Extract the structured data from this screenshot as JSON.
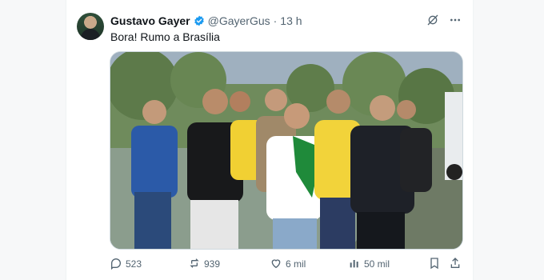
{
  "post": {
    "author_name": "Gustavo Gayer",
    "handle": "@GayerGus",
    "separator": "·",
    "time": "13 h",
    "text": "Bora! Rumo a Brasília"
  },
  "actions": {
    "replies": "523",
    "reposts": "939",
    "likes": "6 mil",
    "views": "50 mil"
  },
  "icons": {
    "verified": "verified-badge-icon",
    "grok": "grok-icon",
    "more": "more-icon",
    "reply": "reply-icon",
    "repost": "repost-icon",
    "like": "like-icon",
    "views": "views-icon",
    "bookmark": "bookmark-icon",
    "share": "share-icon"
  },
  "colors": {
    "verified": "#1d9bf0",
    "text": "#0f1419",
    "muted": "#536471"
  }
}
